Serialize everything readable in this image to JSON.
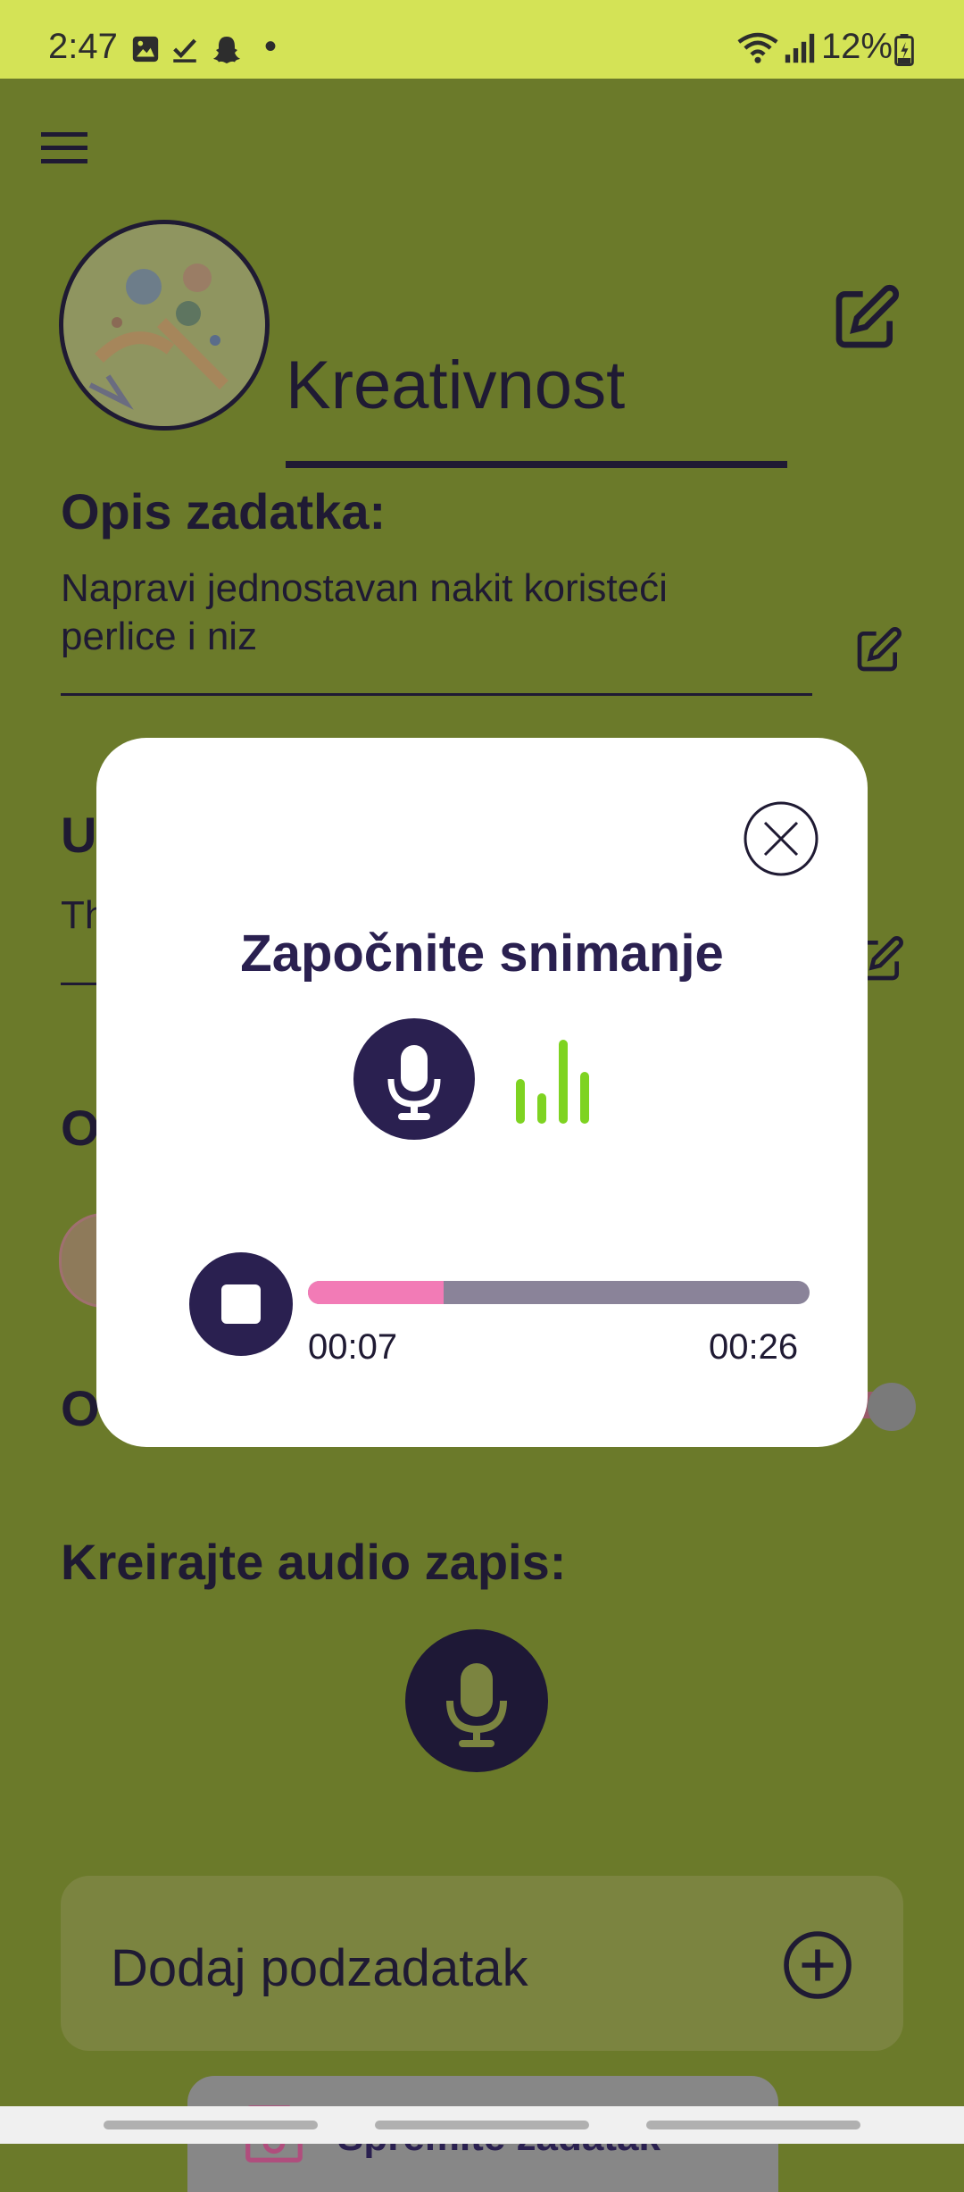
{
  "status_bar": {
    "time": "2:47",
    "dot": "•",
    "battery": "12%"
  },
  "header": {
    "menu_icon": "hamburger-menu-icon"
  },
  "task": {
    "title": "Kreativnost",
    "description_label": "Opis zadatka:",
    "description_text": "Napravi jednostavan nakit koristeći perlice i niz",
    "partial_label_1": "U",
    "partial_text_1": "Th",
    "partial_label_2": "O",
    "partial_label_3": "O"
  },
  "modal": {
    "title": "Započnite snimanje",
    "elapsed": "00:07",
    "total": "00:26",
    "progress_fraction": 0.27
  },
  "audio": {
    "label": "Kreirajte audio zapis:"
  },
  "buttons": {
    "add_subtask": "Dodaj podzadatak",
    "save": "Spremite zadatak"
  },
  "colors": {
    "accent_dark": "#2a2050",
    "progress_fill": "#f27bb6",
    "wave": "#7ed321",
    "app_bg": "#6b7a2a",
    "status_bar": "#d4e356"
  }
}
